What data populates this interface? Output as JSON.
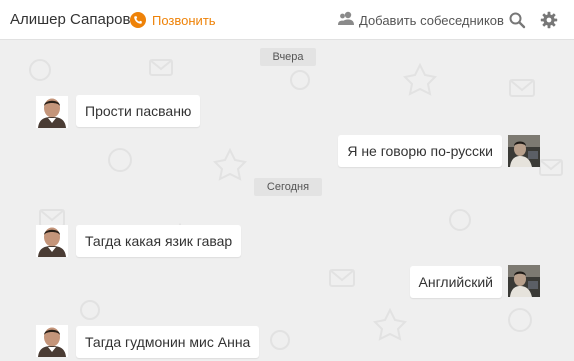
{
  "header": {
    "contact_name": "Алишер Сапаров",
    "call_label": "Позвонить",
    "add_label": "Добавить собеседников"
  },
  "colors": {
    "accent": "#ee8208",
    "bubble": "#ffffff",
    "chat_background": "#efefef",
    "date_separator": "#e3e3e3"
  },
  "icons": {
    "call": "phone-icon",
    "add": "add-users-icon",
    "search": "search-icon",
    "settings": "gear-icon"
  },
  "conversation": {
    "separators": [
      "Вчера",
      "Сегодня"
    ],
    "messages": [
      {
        "text": "Прости пасваню",
        "direction": "incoming"
      },
      {
        "text": "Я не говорю по-русски",
        "direction": "outgoing"
      },
      {
        "text": "Тагда какая язик гавар",
        "direction": "incoming"
      },
      {
        "text": "Английский",
        "direction": "outgoing"
      },
      {
        "text": "Тагда гудмонин мис Анна",
        "direction": "incoming"
      }
    ]
  }
}
